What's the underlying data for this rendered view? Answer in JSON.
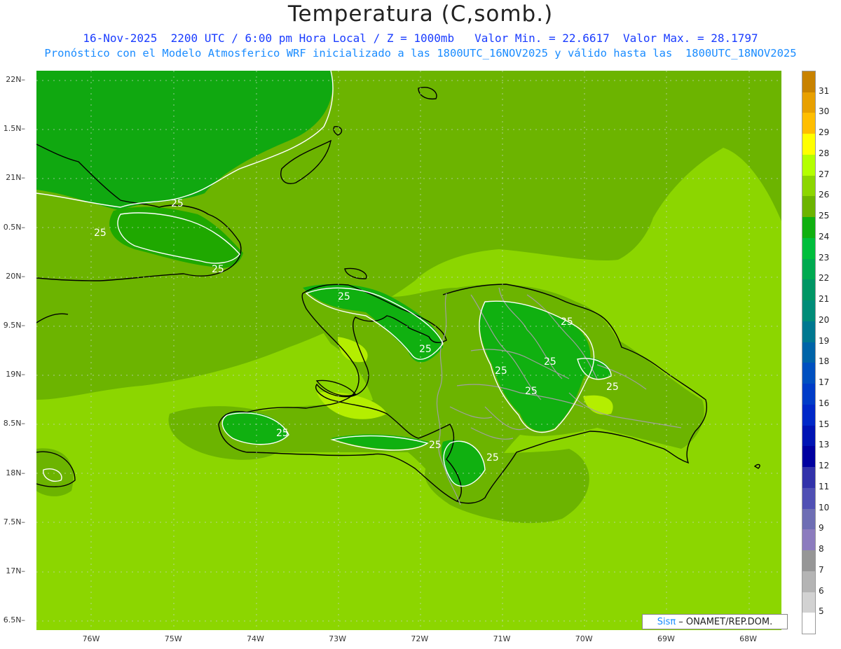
{
  "header": {
    "title": "Temperatura (C,somb.)",
    "line1": "16-Nov-2025  2200 UTC / 6:00 pm Hora Local / Z = 1000mb   Valor Min. = 22.6617  Valor Max. = 28.1797",
    "line2": "Pronóstico con el Modelo Atmosferico WRF inicializado a las 1800UTC_16NOV2025 y válido hasta las  1800UTC_18NOV2025"
  },
  "map": {
    "lat_labels": [
      "22N",
      "1.5N",
      "21N",
      "0.5N",
      "20N",
      "9.5N",
      "19N",
      "8.5N",
      "18N",
      "7.5N",
      "17N",
      "6.5N"
    ],
    "lon_labels": [
      "76W",
      "75W",
      "74W",
      "73W",
      "72W",
      "71W",
      "70W",
      "69W",
      "68W"
    ],
    "contour_label": "25",
    "colors": {
      "t27": "#8cd600",
      "t26": "#6cb400",
      "t25": "#1fa800",
      "t24": "#10b010",
      "t28": "#b4ee00",
      "coast": "#000000",
      "borders": "#999999",
      "contour": "#ffffff"
    }
  },
  "legend": {
    "labels": [
      "31",
      "30",
      "29",
      "28",
      "27",
      "26",
      "25",
      "24",
      "23",
      "22",
      "21",
      "20",
      "19",
      "18",
      "17",
      "16",
      "15",
      "13",
      "12",
      "11",
      "10",
      "9",
      "8",
      "7",
      "6",
      "5"
    ],
    "colors": [
      "#c88200",
      "#e8a000",
      "#ffbe00",
      "#ffff00",
      "#b4ff00",
      "#8cd600",
      "#6cb400",
      "#10b010",
      "#00be3c",
      "#00aa50",
      "#009664",
      "#008c78",
      "#007890",
      "#0064a8",
      "#0050c0",
      "#003cc8",
      "#0028c8",
      "#0014b4",
      "#0000a0",
      "#3232aa",
      "#5050b4",
      "#6e6eb4",
      "#8c7cbe",
      "#969696",
      "#b4b4b4",
      "#d2d2d2",
      "#ffffff"
    ]
  },
  "credit": {
    "brand": "Sisπ",
    "text": "– ONAMET/REP.DOM."
  }
}
